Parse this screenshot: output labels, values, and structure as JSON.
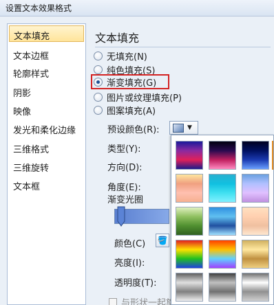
{
  "window": {
    "title": "设置文本效果格式"
  },
  "sidebar": {
    "items": [
      {
        "label": "文本填充",
        "selected": true
      },
      {
        "label": "文本边框",
        "selected": false
      },
      {
        "label": "轮廓样式",
        "selected": false
      },
      {
        "label": "阴影",
        "selected": false
      },
      {
        "label": "映像",
        "selected": false
      },
      {
        "label": "发光和柔化边缘",
        "selected": false
      },
      {
        "label": "三维格式",
        "selected": false
      },
      {
        "label": "三维旋转",
        "selected": false
      },
      {
        "label": "文本框",
        "selected": false
      }
    ]
  },
  "main": {
    "heading": "文本填充",
    "fill_options": [
      {
        "label": "无填充(N)",
        "checked": false
      },
      {
        "label": "纯色填充(S)",
        "checked": false
      },
      {
        "label": "渐变填充(G)",
        "checked": true
      },
      {
        "label": "图片或纹理填充(P)",
        "checked": false
      },
      {
        "label": "图案填充(A)",
        "checked": false
      }
    ],
    "preset_colors_label": "预设颜色(R):",
    "type_label": "类型(Y):",
    "direction_label": "方向(D):",
    "angle_label": "角度(E):",
    "gradient_stops_label": "渐变光圈",
    "color_label": "颜色(C)",
    "brightness_label": "亮度(I):",
    "transparency_label": "透明度(T):",
    "rotate_with_shape_label": "与形状一起旋转"
  },
  "gallery": {
    "accent_color": "#e28a1f",
    "presets": [
      {
        "name": "preset-1",
        "colors": [
          "#1a1a9a",
          "#8a2aa0",
          "#e0205a",
          "#1a1a8a"
        ]
      },
      {
        "name": "preset-2",
        "colors": [
          "#000010",
          "#2a0a50",
          "#c02060",
          "#ff8ac0"
        ]
      },
      {
        "name": "preset-3",
        "colors": [
          "#000020",
          "#001060",
          "#1a3ab0",
          "#6aa0ff"
        ]
      },
      {
        "name": "preset-4",
        "colors": [
          "#ffe6a0",
          "#f0a080",
          "#ffc0b0",
          "#f6b090"
        ]
      },
      {
        "name": "preset-5",
        "colors": [
          "#2ab0d0",
          "#10c0e0",
          "#40e0f0",
          "#80f0ff"
        ]
      },
      {
        "name": "preset-6",
        "colors": [
          "#6aa0e0",
          "#b0c0ff",
          "#e0c0ff",
          "#c090e0"
        ]
      },
      {
        "name": "preset-7",
        "colors": [
          "#e0f0c0",
          "#90c060",
          "#509030",
          "#306020"
        ]
      },
      {
        "name": "preset-8",
        "colors": [
          "#3090e0",
          "#60c0f0",
          "#2050a0",
          "#a0e0ff"
        ]
      },
      {
        "name": "preset-9",
        "colors": [
          "#ffe0c0",
          "#ffd0b0",
          "#f0c0a0",
          "#ffe8d0"
        ]
      },
      {
        "name": "preset-10",
        "colors": [
          "#e02020",
          "#ffe000",
          "#20c020",
          "#2040e0"
        ]
      },
      {
        "name": "preset-11",
        "colors": [
          "#ff4000",
          "#ffc000",
          "#60d0ff",
          "#a040ff"
        ]
      },
      {
        "name": "preset-12",
        "colors": [
          "#d0b060",
          "#ffe8a0",
          "#c09040",
          "#f0d080"
        ]
      },
      {
        "name": "preset-13",
        "colors": [
          "#606060",
          "#e0e0e0",
          "#808080",
          "#f0f0f0"
        ]
      },
      {
        "name": "preset-14",
        "colors": [
          "#404040",
          "#c0c0c0",
          "#707070",
          "#e8e8e8"
        ]
      },
      {
        "name": "preset-15",
        "colors": [
          "#707070",
          "#ffffff",
          "#909090",
          "#d0d0d0"
        ]
      }
    ]
  }
}
